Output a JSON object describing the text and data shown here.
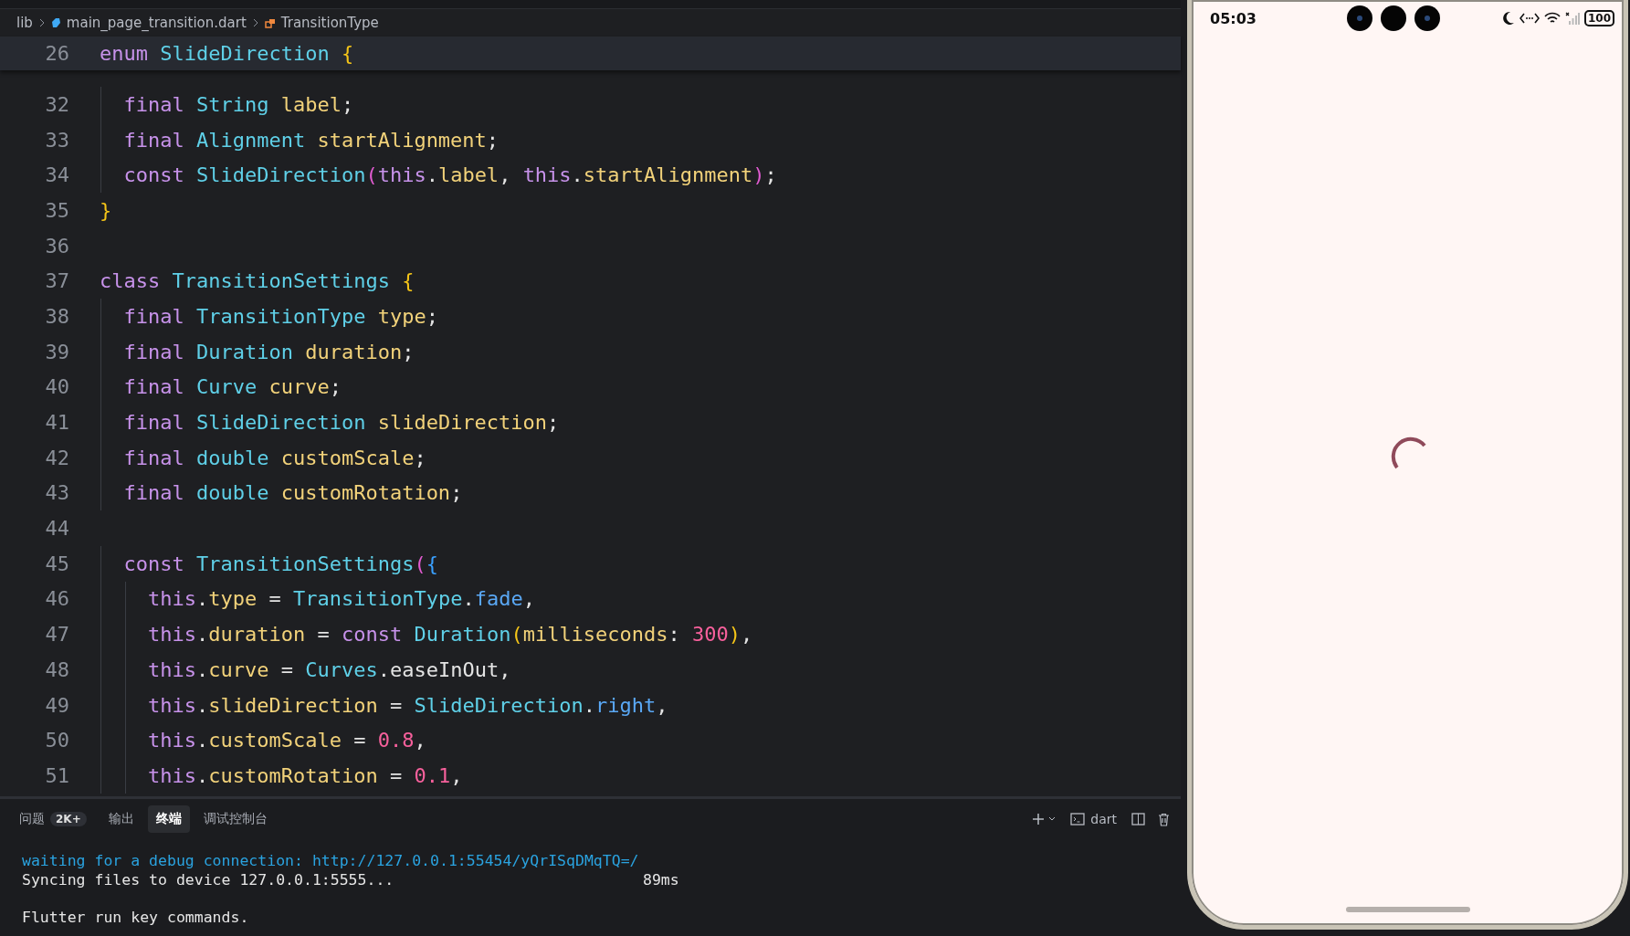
{
  "breadcrumb": [
    {
      "kind": "folder",
      "label": "lib"
    },
    {
      "kind": "file",
      "label": "main_page_transition.dart"
    },
    {
      "kind": "symbol",
      "label": "TransitionType"
    }
  ],
  "sticky_line": {
    "number": "26",
    "tokens": [
      {
        "kind": "keyword",
        "text": "enum "
      },
      {
        "kind": "type",
        "text": "SlideDirection "
      },
      {
        "kind": "brace",
        "text": "{"
      }
    ]
  },
  "code_lines": [
    {
      "number": "32",
      "tokens": [
        {
          "kind": "keyword",
          "text": "  final "
        },
        {
          "kind": "type",
          "text": "String "
        },
        {
          "kind": "field",
          "text": "label"
        },
        {
          "kind": "plain",
          "text": ";"
        }
      ]
    },
    {
      "number": "33",
      "tokens": [
        {
          "kind": "keyword",
          "text": "  final "
        },
        {
          "kind": "type",
          "text": "Alignment "
        },
        {
          "kind": "field",
          "text": "startAlignment"
        },
        {
          "kind": "plain",
          "text": ";"
        }
      ]
    },
    {
      "number": "34",
      "tokens": [
        {
          "kind": "keyword",
          "text": "  const "
        },
        {
          "kind": "type",
          "text": "SlideDirection"
        },
        {
          "kind": "paren",
          "text": "("
        },
        {
          "kind": "keyword",
          "text": "this"
        },
        {
          "kind": "plain",
          "text": "."
        },
        {
          "kind": "field",
          "text": "label"
        },
        {
          "kind": "plain",
          "text": ", "
        },
        {
          "kind": "keyword",
          "text": "this"
        },
        {
          "kind": "plain",
          "text": "."
        },
        {
          "kind": "field",
          "text": "startAlignment"
        },
        {
          "kind": "paren",
          "text": ")"
        },
        {
          "kind": "plain",
          "text": ";"
        }
      ]
    },
    {
      "number": "35",
      "tokens": [
        {
          "kind": "brace",
          "text": "}"
        }
      ]
    },
    {
      "number": "36"
    },
    {
      "number": "37",
      "tokens": [
        {
          "kind": "keyword",
          "text": "class "
        },
        {
          "kind": "type",
          "text": "TransitionSettings "
        },
        {
          "kind": "brace",
          "text": "{"
        }
      ]
    },
    {
      "number": "38",
      "tokens": [
        {
          "kind": "keyword",
          "text": "  final "
        },
        {
          "kind": "type",
          "text": "TransitionType "
        },
        {
          "kind": "field",
          "text": "type"
        },
        {
          "kind": "plain",
          "text": ";"
        }
      ]
    },
    {
      "number": "39",
      "tokens": [
        {
          "kind": "keyword",
          "text": "  final "
        },
        {
          "kind": "type",
          "text": "Duration "
        },
        {
          "kind": "field",
          "text": "duration"
        },
        {
          "kind": "plain",
          "text": ";"
        }
      ]
    },
    {
      "number": "40",
      "tokens": [
        {
          "kind": "keyword",
          "text": "  final "
        },
        {
          "kind": "type",
          "text": "Curve "
        },
        {
          "kind": "field",
          "text": "curve"
        },
        {
          "kind": "plain",
          "text": ";"
        }
      ]
    },
    {
      "number": "41",
      "tokens": [
        {
          "kind": "keyword",
          "text": "  final "
        },
        {
          "kind": "type",
          "text": "SlideDirection "
        },
        {
          "kind": "field",
          "text": "slideDirection"
        },
        {
          "kind": "plain",
          "text": ";"
        }
      ]
    },
    {
      "number": "42",
      "tokens": [
        {
          "kind": "keyword",
          "text": "  final "
        },
        {
          "kind": "type",
          "text": "double "
        },
        {
          "kind": "field",
          "text": "customScale"
        },
        {
          "kind": "plain",
          "text": ";"
        }
      ]
    },
    {
      "number": "43",
      "tokens": [
        {
          "kind": "keyword",
          "text": "  final "
        },
        {
          "kind": "type",
          "text": "double "
        },
        {
          "kind": "field",
          "text": "customRotation"
        },
        {
          "kind": "plain",
          "text": ";"
        }
      ]
    },
    {
      "number": "44"
    },
    {
      "number": "45",
      "tokens": [
        {
          "kind": "keyword",
          "text": "  const "
        },
        {
          "kind": "type",
          "text": "TransitionSettings"
        },
        {
          "kind": "paren",
          "text": "("
        },
        {
          "kind": "bracket",
          "text": "{"
        }
      ]
    },
    {
      "number": "46",
      "tokens": [
        {
          "kind": "keyword",
          "text": "    this"
        },
        {
          "kind": "plain",
          "text": "."
        },
        {
          "kind": "field",
          "text": "type"
        },
        {
          "kind": "plain",
          "text": " = "
        },
        {
          "kind": "type",
          "text": "TransitionType"
        },
        {
          "kind": "plain",
          "text": "."
        },
        {
          "kind": "member",
          "text": "fade"
        },
        {
          "kind": "plain",
          "text": ","
        }
      ]
    },
    {
      "number": "47",
      "tokens": [
        {
          "kind": "keyword",
          "text": "    this"
        },
        {
          "kind": "plain",
          "text": "."
        },
        {
          "kind": "field",
          "text": "duration"
        },
        {
          "kind": "plain",
          "text": " = "
        },
        {
          "kind": "keyword",
          "text": "const "
        },
        {
          "kind": "type",
          "text": "Duration"
        },
        {
          "kind": "brace",
          "text": "("
        },
        {
          "kind": "field",
          "text": "milliseconds"
        },
        {
          "kind": "plain",
          "text": ": "
        },
        {
          "kind": "number",
          "text": "300"
        },
        {
          "kind": "brace",
          "text": ")"
        },
        {
          "kind": "plain",
          "text": ","
        }
      ]
    },
    {
      "number": "48",
      "tokens": [
        {
          "kind": "keyword",
          "text": "    this"
        },
        {
          "kind": "plain",
          "text": "."
        },
        {
          "kind": "field",
          "text": "curve"
        },
        {
          "kind": "plain",
          "text": " = "
        },
        {
          "kind": "type",
          "text": "Curves"
        },
        {
          "kind": "plain",
          "text": ".easeInOut,"
        }
      ]
    },
    {
      "number": "49",
      "tokens": [
        {
          "kind": "keyword",
          "text": "    this"
        },
        {
          "kind": "plain",
          "text": "."
        },
        {
          "kind": "field",
          "text": "slideDirection"
        },
        {
          "kind": "plain",
          "text": " = "
        },
        {
          "kind": "type",
          "text": "SlideDirection"
        },
        {
          "kind": "plain",
          "text": "."
        },
        {
          "kind": "member",
          "text": "right"
        },
        {
          "kind": "plain",
          "text": ","
        }
      ]
    },
    {
      "number": "50",
      "tokens": [
        {
          "kind": "keyword",
          "text": "    this"
        },
        {
          "kind": "plain",
          "text": "."
        },
        {
          "kind": "field",
          "text": "customScale"
        },
        {
          "kind": "plain",
          "text": " = "
        },
        {
          "kind": "number",
          "text": "0.8"
        },
        {
          "kind": "plain",
          "text": ","
        }
      ]
    },
    {
      "number": "51",
      "tokens": [
        {
          "kind": "keyword",
          "text": "    this"
        },
        {
          "kind": "plain",
          "text": "."
        },
        {
          "kind": "field",
          "text": "customRotation"
        },
        {
          "kind": "plain",
          "text": " = "
        },
        {
          "kind": "number",
          "text": "0.1"
        },
        {
          "kind": "plain",
          "text": ","
        }
      ]
    }
  ],
  "panel": {
    "tabs": [
      {
        "label": "问题",
        "badge": "2K+",
        "selected": false
      },
      {
        "label": "输出",
        "selected": false
      },
      {
        "label": "终端",
        "selected": true
      },
      {
        "label": "调试控制台",
        "selected": false
      }
    ],
    "terminal_profile": "dart",
    "terminal_lines": [
      {
        "kind": "link",
        "text": "waiting for a debug connection: http://127.0.0.1:55454/yQrISqDMqTQ=/"
      },
      {
        "kind": "plain",
        "text": "Syncing files to device 127.0.0.1:5555...",
        "timing": "89ms"
      },
      {
        "kind": "blank"
      },
      {
        "kind": "plain",
        "text": "Flutter run key commands."
      }
    ]
  },
  "phone": {
    "time": "05:03",
    "battery": "100"
  }
}
